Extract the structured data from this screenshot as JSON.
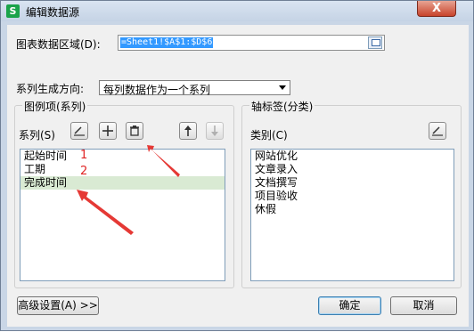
{
  "window": {
    "title": "编辑数据源",
    "close_label": "X",
    "app_icon": "S"
  },
  "data_range": {
    "label": "图表数据区域(D):",
    "value": "=Sheet1!$A$1:$D$6"
  },
  "series_direction": {
    "label": "系列生成方向:",
    "selected": "每列数据作为一个系列"
  },
  "legend_group": {
    "title": "图例项(系列)",
    "toolbar_label": "系列(S)",
    "items": [
      "起始时间",
      "工期",
      "完成时间"
    ],
    "annotations": [
      "1",
      "2"
    ]
  },
  "axis_group": {
    "title": "轴标签(分类)",
    "toolbar_label": "类别(C)",
    "items": [
      "网站优化",
      "文章录入",
      "文档撰写",
      "项目验收",
      "休假"
    ]
  },
  "buttons": {
    "advanced": "高级设置(A) >>",
    "ok": "确定",
    "cancel": "取消"
  },
  "colors": {
    "annotation": "#e02424",
    "selected_row": "#d9ead3",
    "title_bar": "#c9d6e6"
  }
}
